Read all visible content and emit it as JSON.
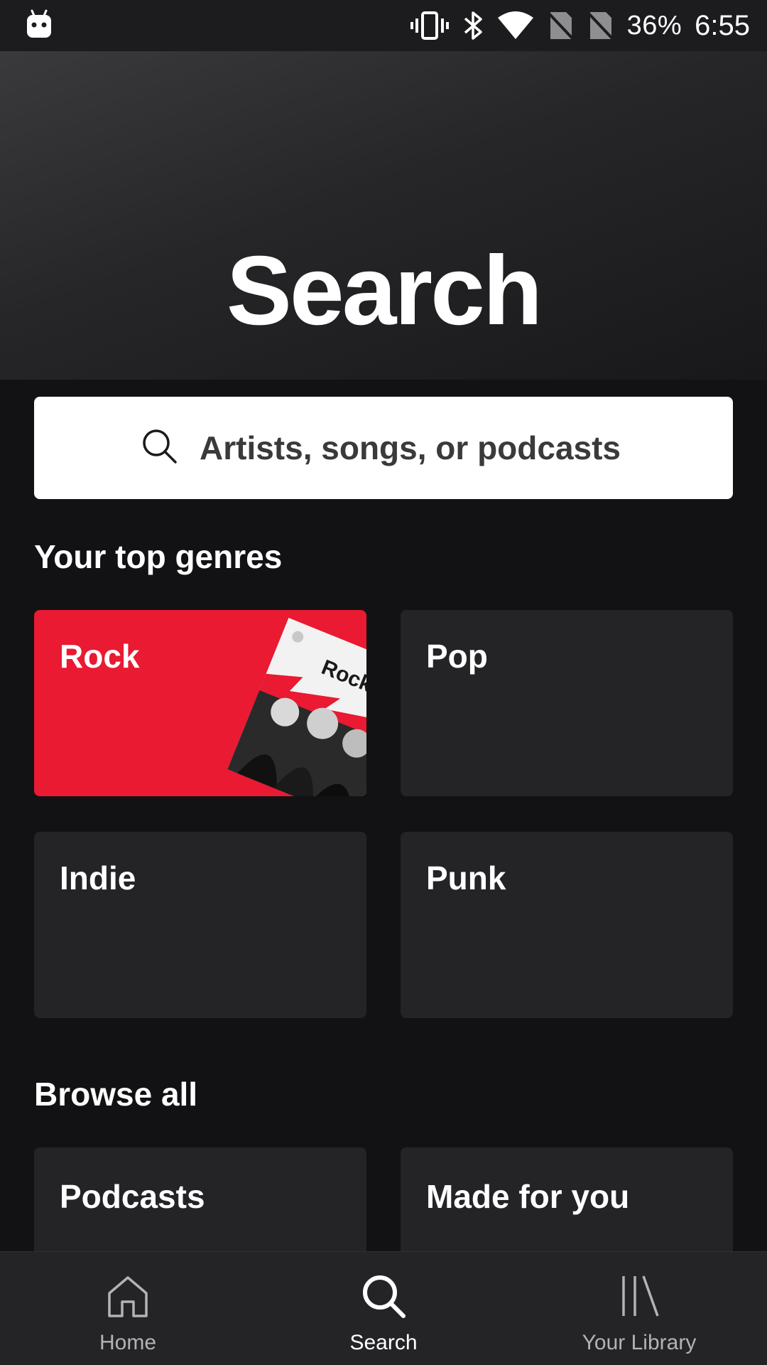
{
  "status_bar": {
    "battery": "36%",
    "time": "6:55",
    "icons": [
      "android-robot-icon",
      "vibrate-icon",
      "bluetooth-icon",
      "wifi-icon",
      "no-sim-icon",
      "no-sim-icon"
    ]
  },
  "header": {
    "title": "Search"
  },
  "search": {
    "placeholder": "Artists, songs, or podcasts",
    "icon": "search-icon"
  },
  "top_genres": {
    "title": "Your top genres",
    "tiles": [
      {
        "label": "Rock",
        "color": "#e91a32",
        "artwork_text": "Rock"
      },
      {
        "label": "Pop",
        "color": "#242427"
      },
      {
        "label": "Indie",
        "color": "#242427"
      },
      {
        "label": "Punk",
        "color": "#242427"
      }
    ]
  },
  "browse_all": {
    "title": "Browse all",
    "tiles": [
      {
        "label": "Podcasts"
      },
      {
        "label": "Made for you"
      }
    ]
  },
  "bottom_nav": {
    "items": [
      {
        "label": "Home",
        "icon": "home-icon",
        "active": false
      },
      {
        "label": "Search",
        "icon": "search-icon",
        "active": true
      },
      {
        "label": "Your Library",
        "icon": "library-icon",
        "active": false
      }
    ]
  },
  "colors": {
    "background": "#121214",
    "card": "#242427",
    "rock": "#e91a32",
    "nav_inactive": "#b3b3b3"
  }
}
